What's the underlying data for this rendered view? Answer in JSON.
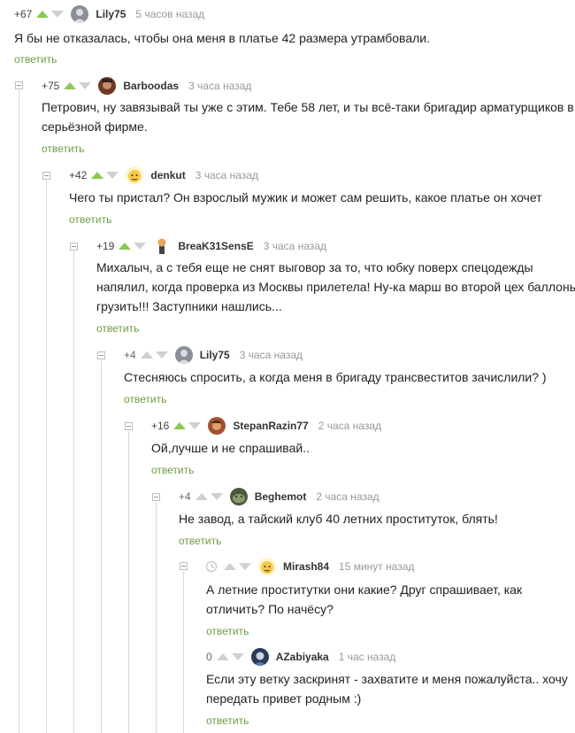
{
  "comments": [
    {
      "rating": "+67",
      "author": "Lily75",
      "time": "5 часов назад",
      "text": [
        "Я бы не отказалась, чтобы она меня в платье 42 размера утрамбовали."
      ],
      "reply": "ответить"
    },
    {
      "rating": "+75",
      "author": "Barboodas",
      "time": "3 часа назад",
      "text": [
        "Петрович, ну завязывай ты уже с этим. Тебе 58 лет, и ты всё-таки бригадир арматурщиков в",
        "серьёзной фирме."
      ],
      "reply": "ответить"
    },
    {
      "rating": "+42",
      "author": "denkut",
      "time": "3 часа назад",
      "text": [
        "Чего ты пристал? Он взрослый мужик и может сам решить, какое платье он хочет"
      ],
      "reply": "ответить"
    },
    {
      "rating": "+19",
      "author": "BreaK31SensE",
      "time": "3 часа назад",
      "text": [
        "Михалыч, а с тебя еще не снят выговор за то, что юбку поверх спецодежды",
        "напялил, когда проверка из Москвы прилетела! Ну-ка марш во второй цех баллоны",
        "грузить!!! Заступники нашлись..."
      ],
      "reply": "ответить"
    },
    {
      "rating": "+4",
      "author": "Lily75",
      "time": "3 часа назад",
      "text": [
        "Стесняюсь спросить, а когда меня в бригаду трансвеститов зачислили? )"
      ],
      "reply": "ответить"
    },
    {
      "rating": "+16",
      "author": "StepanRazin77",
      "time": "2 часа назад",
      "text": [
        "Ой,лучше и не спрашивай.."
      ],
      "reply": "ответить"
    },
    {
      "rating": "+4",
      "author": "Beghemot",
      "time": "2 часа назад",
      "text": [
        "Не завод, а тайский клуб 40 летних проституток, блять!"
      ],
      "reply": "ответить"
    },
    {
      "rating": "",
      "author": "Mirash84",
      "time": "15 минут назад",
      "text": [
        "А летние проститутки они какие? Друг спрашивает, как",
        "отличить? По начёсу?"
      ],
      "reply": "ответить"
    },
    {
      "rating": "0",
      "author": "AZabiyaka",
      "time": "1 час назад",
      "text": [
        "Если эту ветку заскринят - захватите и меня пожалуйста.. хочу",
        "передать привет родным :)"
      ],
      "reply": "ответить"
    }
  ],
  "colors": {
    "upvote": "#8ac858",
    "reply_link": "#6f9d43",
    "neutral_arrow": "#d0d0d0"
  }
}
